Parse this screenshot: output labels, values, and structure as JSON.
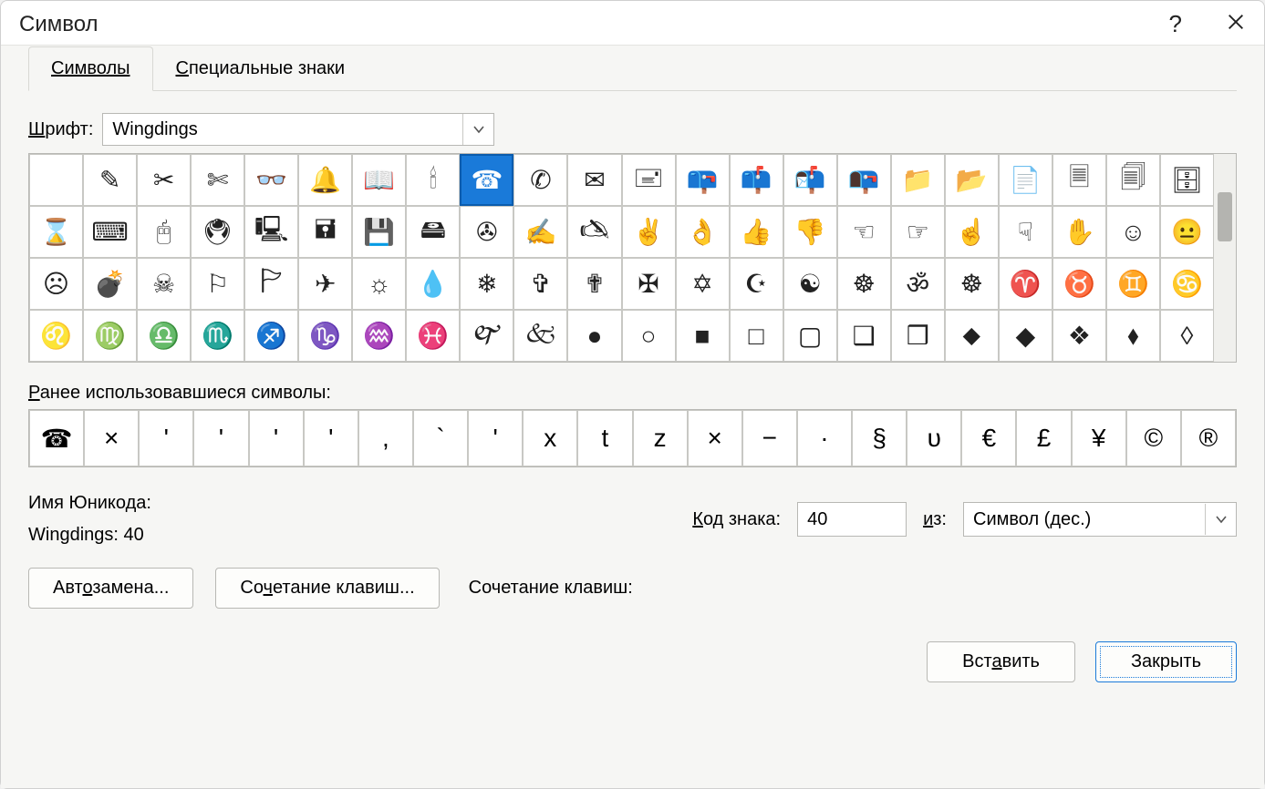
{
  "dialog": {
    "title": "Символ"
  },
  "tabs": {
    "symbols": "Символы",
    "special": "Специальные знаки"
  },
  "font": {
    "label_prefix": "Ш",
    "label_rest": "рифт:",
    "value": "Wingdings"
  },
  "grid": {
    "rows": [
      [
        "",
        "✎",
        "✂",
        "✄",
        "👓",
        "🔔",
        "📖",
        "🕯",
        "☎",
        "✆",
        "✉",
        "🖃",
        "📪",
        "📫",
        "📬",
        "📭",
        "📁",
        "📂",
        "📄",
        "🗏",
        "🗐",
        "🗄"
      ],
      [
        "⌛",
        "⌨",
        "🖰",
        "🖲",
        "🖳",
        "🖬",
        "💾",
        "🖴",
        "✇",
        "✍",
        "🖎",
        "✌",
        "👌",
        "👍",
        "👎",
        "☜",
        "☞",
        "☝",
        "☟",
        "✋",
        "☺",
        "😐"
      ],
      [
        "☹",
        "💣",
        "☠",
        "⚐",
        "🏱",
        "✈",
        "☼",
        "💧",
        "❄",
        "✞",
        "✟",
        "✠",
        "✡",
        "☪",
        "☯",
        "☸",
        "ॐ",
        "☸",
        "♈",
        "♉",
        "♊",
        "♋"
      ],
      [
        "♌",
        "♍",
        "♎",
        "♏",
        "♐",
        "♑",
        "♒",
        "♓",
        "🙰",
        "🙵",
        "●",
        "○",
        "■",
        "□",
        "▢",
        "❑",
        "❒",
        "⬥",
        "◆",
        "❖",
        "⬧",
        "◊"
      ]
    ],
    "selected": {
      "row": 0,
      "col": 8
    }
  },
  "recent": {
    "label_prefix": "Р",
    "label_rest": "анее использовавшиеся символы:",
    "items": [
      "☎",
      "×",
      "ʹ",
      "ʹ",
      "ʹ",
      "ʹ",
      ",",
      "`",
      "ʹ",
      "x",
      "t",
      "z",
      "×",
      "−",
      "·",
      "§",
      "υ",
      "€",
      "£",
      "¥",
      "©",
      "®"
    ]
  },
  "info": {
    "unicode_label": "Имя Юникода:",
    "unicode_value": "Wingdings: 40",
    "code_label_prefix": "К",
    "code_label_rest": "од знака:",
    "code_value": "40",
    "from_label_prefix": "и",
    "from_label_rest": "з:",
    "from_value": "Символ (дес.)"
  },
  "buttons": {
    "autocorrect": "Автозамена...",
    "shortcut_btn_prefix": "Со",
    "shortcut_btn_u": "ч",
    "shortcut_btn_rest": "етание клавиш...",
    "shortcut_label": "Сочетание клавиш:",
    "insert_prefix": "Вст",
    "insert_u": "а",
    "insert_rest": "вить",
    "close": "Закрыть"
  }
}
